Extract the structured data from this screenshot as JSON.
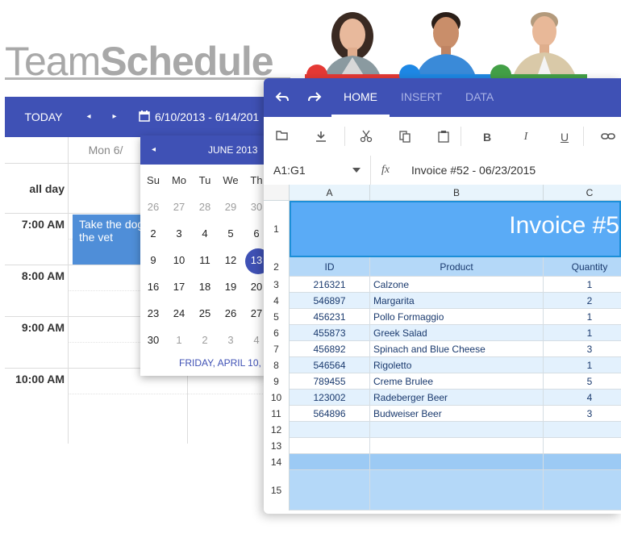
{
  "title": {
    "light": "Team",
    "bold": "Schedule"
  },
  "avatars": [
    {
      "name": "woman-avatar",
      "badge_color": "#e53935"
    },
    {
      "name": "man-avatar",
      "badge_color": "#1e88e5"
    },
    {
      "name": "older-man-avatar",
      "badge_color": "#43a047"
    }
  ],
  "scheduler": {
    "today_label": "TODAY",
    "prev_icon": "◂",
    "next_icon": "▸",
    "date_range": "6/10/2013 - 6/14/201",
    "day_header": "Mon 6/",
    "all_day_label": "all day",
    "times": [
      "7:00 AM",
      "8:00 AM",
      "9:00 AM",
      "10:00 AM"
    ],
    "event": {
      "line1": "Take the dog",
      "line2": "the vet"
    },
    "accent": "#3f51b5",
    "event_color": "#4f8ed8"
  },
  "mini_calendar": {
    "prev_icon": "◂",
    "title": "JUNE 2013",
    "weekdays": [
      "Su",
      "Mo",
      "Tu",
      "We",
      "Th"
    ],
    "weeks": [
      [
        "26",
        "27",
        "28",
        "29",
        "30"
      ],
      [
        "2",
        "3",
        "4",
        "5",
        "6"
      ],
      [
        "9",
        "10",
        "11",
        "12",
        "13"
      ],
      [
        "16",
        "17",
        "18",
        "19",
        "20"
      ],
      [
        "23",
        "24",
        "25",
        "26",
        "27"
      ],
      [
        "30",
        "1",
        "2",
        "3",
        "4"
      ]
    ],
    "selected": "13",
    "footer": "FRIDAY, APRIL 10,"
  },
  "spreadsheet": {
    "tabs": [
      "HOME",
      "INSERT",
      "DATA"
    ],
    "active_tab": "HOME",
    "tool_icons": [
      "folder-open-icon",
      "download-icon",
      "cut-icon",
      "copy-icon",
      "paste-icon",
      "bold-icon",
      "italic-icon",
      "underline-icon",
      "link-icon"
    ],
    "tool_labels": {
      "bold": "B",
      "italic": "I",
      "underline": "U"
    },
    "cell_ref": "A1:G1",
    "fx_label": "fx",
    "formula_value": "Invoice #52 - 06/23/2015",
    "columns": [
      "A",
      "B",
      "C"
    ],
    "invoice_title": "Invoice #5",
    "headers": [
      "ID",
      "Product",
      "Quantity"
    ],
    "row_numbers": [
      "1",
      "2",
      "3",
      "4",
      "5",
      "6",
      "7",
      "8",
      "9",
      "10",
      "11",
      "12",
      "13",
      "14",
      "15"
    ],
    "rows": [
      [
        "216321",
        "Calzone",
        "1"
      ],
      [
        "546897",
        "Margarita",
        "2"
      ],
      [
        "456231",
        "Pollo Formaggio",
        "1"
      ],
      [
        "455873",
        "Greek Salad",
        "1"
      ],
      [
        "456892",
        "Spinach and Blue Cheese",
        "3"
      ],
      [
        "546564",
        "Rigoletto",
        "1"
      ],
      [
        "789455",
        "Creme Brulee",
        "5"
      ],
      [
        "123002",
        "Radeberger Beer",
        "4"
      ],
      [
        "564896",
        "Budweiser Beer",
        "3"
      ]
    ],
    "colors": {
      "header_bg": "#3f51b5",
      "band": "#5aabf6",
      "stripe": "#e3f1fd",
      "total": "#b4d8f8",
      "total_dark": "#9ccaf4"
    }
  }
}
